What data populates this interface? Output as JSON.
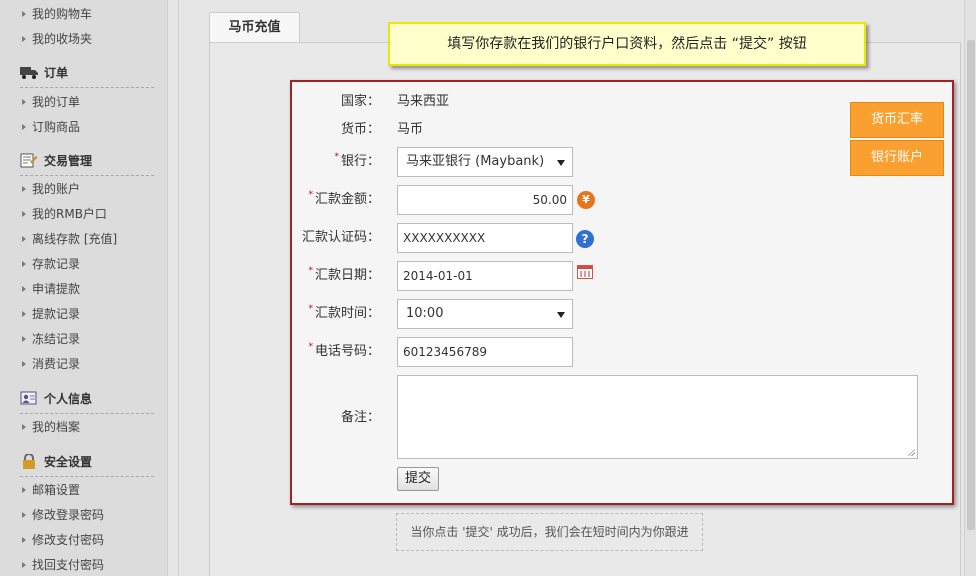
{
  "sidebar": {
    "top_items": [
      {
        "label": "我的购物车"
      },
      {
        "label": "我的收场夹"
      }
    ],
    "sections": [
      {
        "title": "订单",
        "icon": "truck-icon",
        "items": [
          "我的订单",
          "订购商品"
        ]
      },
      {
        "title": "交易管理",
        "icon": "transaction-icon",
        "items": [
          "我的账户",
          "我的RMB户口",
          "离线存款 [充值]",
          "存款记录",
          "申请提款",
          "提款记录",
          "冻结记录",
          "消费记录"
        ]
      },
      {
        "title": "个人信息",
        "icon": "id-card-icon",
        "items": [
          "我的档案"
        ]
      },
      {
        "title": "安全设置",
        "icon": "lock-icon",
        "items": [
          "邮箱设置",
          "修改登录密码",
          "修改支付密码",
          "找回支付密码"
        ]
      }
    ]
  },
  "tab": {
    "label": "马币充值"
  },
  "tooltip": {
    "text": "填写你存款在我们的银行户口资料，然后点击 “提交” 按钮"
  },
  "form": {
    "country": {
      "label": "国家：",
      "value": "马来西亚"
    },
    "currency": {
      "label": "货币：",
      "value": "马币"
    },
    "bank": {
      "label": "银行：",
      "value": "马来亚银行 (Maybank)"
    },
    "amount": {
      "label": "汇款金额：",
      "value": "50.00"
    },
    "auth_code": {
      "label": "汇款认证码：",
      "value": "XXXXXXXXXX"
    },
    "date": {
      "label": "汇款日期：",
      "value": "2014-01-01"
    },
    "time": {
      "label": "汇款时间：",
      "value": "10:00"
    },
    "phone": {
      "label": "电话号码：",
      "value": "60123456789"
    },
    "remarks": {
      "label": "备注：",
      "value": ""
    },
    "submit_label": "提交",
    "required_mark": "*"
  },
  "buttons": {
    "exchange_rate": "货币汇率",
    "bank_account": "银行账户"
  },
  "note": {
    "text": "当你点击 '提交' 成功后，我们会在短时间内为你跟进"
  },
  "icons": {
    "yen_glyph": "¥",
    "help_glyph": "?"
  },
  "colors": {
    "accent_orange": "#f9a030",
    "form_border": "#a02222",
    "tooltip_bg": "#ffffcc",
    "required": "#cc0000"
  }
}
